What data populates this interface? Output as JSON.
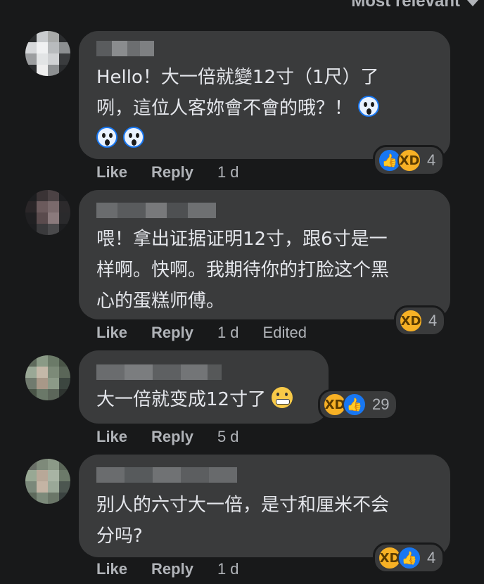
{
  "header": {
    "sort_label": "Most relevant"
  },
  "comments": [
    {
      "text_line1": "Hello！大一倍就變12寸（1尺）了",
      "text_line2": "咧，這位人客妳會不會的哦？！",
      "reactions": {
        "icons": [
          "like-icon",
          "haha-icon"
        ],
        "count": "4"
      },
      "actions": {
        "like": "Like",
        "reply": "Reply",
        "time": "1 d"
      }
    },
    {
      "text_line1": "喂！拿出证据证明12寸，跟6寸是一",
      "text_line2": "样啊。快啊。我期待你的打脸这个黑",
      "text_line3": "心的蛋糕师傅。",
      "reactions": {
        "icons": [
          "haha-icon"
        ],
        "count": "4"
      },
      "actions": {
        "like": "Like",
        "reply": "Reply",
        "time": "1 d",
        "edited": "Edited"
      }
    },
    {
      "text_line1": "大一倍就变成12寸了",
      "reactions": {
        "icons": [
          "haha-icon",
          "like-icon"
        ],
        "count": "29"
      },
      "actions": {
        "like": "Like",
        "reply": "Reply",
        "time": "5 d"
      }
    },
    {
      "text_line1": "别人的六寸大一倍，是寸和厘米不会",
      "text_line2": "分吗?",
      "reactions": {
        "icons": [
          "haha-icon",
          "like-icon"
        ],
        "count": "4"
      },
      "actions": {
        "like": "Like",
        "reply": "Reply",
        "time": "1 d"
      }
    }
  ],
  "colors": {
    "background": "#18191a",
    "bubble": "#3a3b3c",
    "text": "#e4e6eb",
    "secondary": "#b0b3b8",
    "like_blue": "#1877f2",
    "haha_yellow": "#f7b125"
  }
}
